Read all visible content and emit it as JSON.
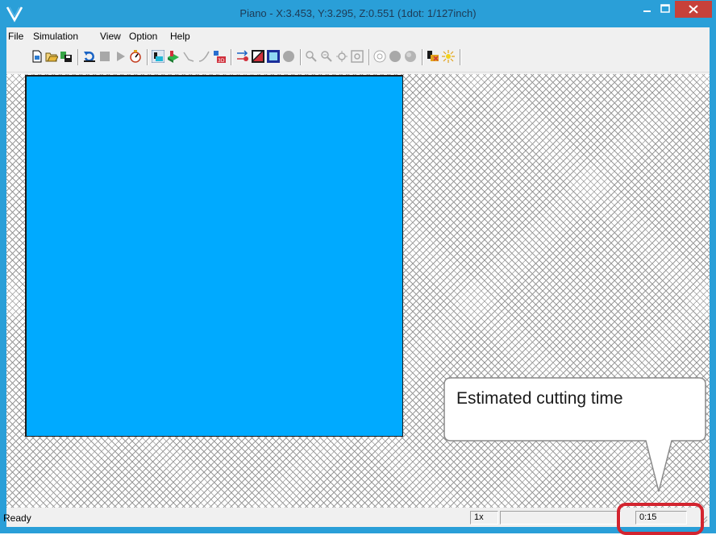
{
  "window": {
    "title": "Piano - X:3.453, Y:3.295, Z:0.551 (1dot: 1/127inch)",
    "app_icon": "v-logo-icon",
    "controls": [
      "minimize-icon",
      "maximize-icon",
      "close-icon"
    ]
  },
  "menu": {
    "items": [
      "File",
      "Simulation",
      "View",
      "Option",
      "Help"
    ]
  },
  "toolbar": {
    "buttons": [
      "new-file-icon",
      "open-folder-icon",
      "save-icon",
      "rewind-icon",
      "stop-icon",
      "play-icon",
      "speed-icon",
      "top-view-icon",
      "isometric-view-icon",
      "path-line-icon",
      "path-curve-icon",
      "view-3d-icon",
      "cut-direction-icon",
      "color-icon",
      "fill-icon",
      "sphere-icon",
      "zoom-in-icon",
      "zoom-out-icon",
      "zoom-fit-icon",
      "zoom-window-icon",
      "shade-1-icon",
      "shade-2-icon",
      "shade-3-icon",
      "tool-color-icon",
      "light-icon"
    ],
    "label_3d": "3D"
  },
  "status": {
    "message": "Ready",
    "speed": "1x",
    "time": "0:15"
  },
  "callout": {
    "text": "Estimated cutting time"
  },
  "colors": {
    "titlebar": "#2a9fd8",
    "close_button": "#c7413a",
    "workpiece": "#00aaff",
    "highlight": "#d3242f"
  }
}
